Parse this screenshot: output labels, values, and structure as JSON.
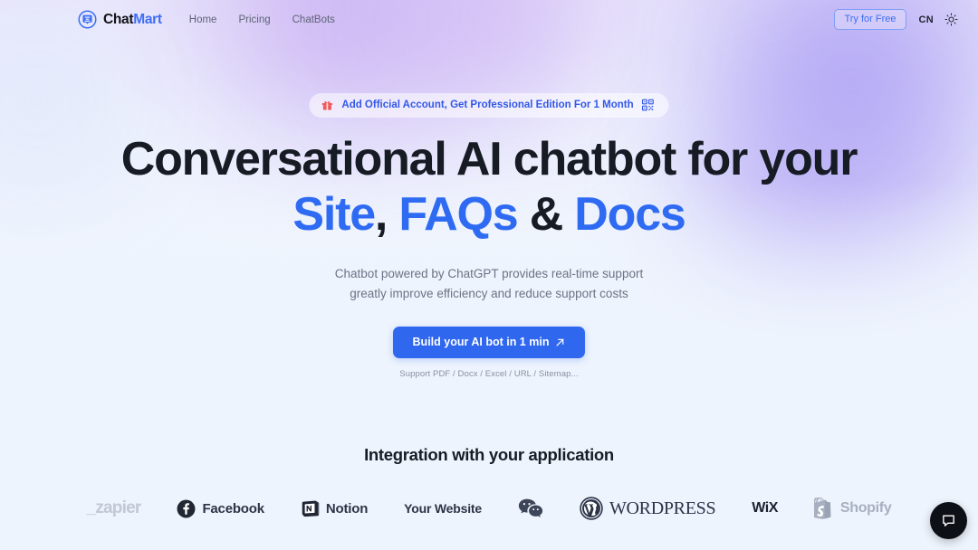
{
  "brand": {
    "name_dark": "Chat",
    "name_accent": "Mart",
    "logo_icon": "chat-bubble-lines-icon"
  },
  "nav": {
    "items": [
      {
        "label": "Home"
      },
      {
        "label": "Pricing"
      },
      {
        "label": "ChatBots"
      }
    ]
  },
  "header_actions": {
    "try_label": "Try for Free",
    "language_label": "CN",
    "theme_icon": "sun-icon"
  },
  "promo": {
    "gift_icon": "gift-icon",
    "text": "Add Official Account, Get Professional Edition For 1 Month",
    "qr_icon": "qr-code-icon"
  },
  "hero": {
    "headline_line1": "Conversational AI chatbot for your",
    "headline_part_site": "Site",
    "headline_comma": ",",
    "headline_part_faqs": "FAQs",
    "headline_amp": "&",
    "headline_part_docs": "Docs",
    "subtitle_line1": "Chatbot powered by ChatGPT provides real-time support",
    "subtitle_line2": "greatly improve efficiency and reduce support costs",
    "cta_label": "Build your AI bot in 1 min",
    "cta_icon": "arrow-up-right-icon",
    "support_note": "Support PDF / Docx / Excel / URL / Sitemap..."
  },
  "integration": {
    "title": "Integration with your application",
    "logos": [
      {
        "name": "Zapier",
        "label": "zapier",
        "icon": "zapier-logo"
      },
      {
        "name": "Facebook",
        "label": "Facebook",
        "icon": "facebook-logo"
      },
      {
        "name": "Notion",
        "label": "Notion",
        "icon": "notion-logo"
      },
      {
        "name": "Your Website",
        "label": "Your Website",
        "icon": "none"
      },
      {
        "name": "WeChat",
        "label": "",
        "icon": "wechat-logo"
      },
      {
        "name": "WordPress",
        "label": "WORDPRESS",
        "icon": "wordpress-logo"
      },
      {
        "name": "Wix",
        "label": "WiX",
        "icon": "wix-logo"
      },
      {
        "name": "Shopify",
        "label": "Shopify",
        "icon": "shopify-logo"
      }
    ]
  },
  "chat_widget": {
    "icon": "chat-bubble-icon"
  },
  "colors": {
    "accent_blue": "#2f6bf2",
    "brand_blue": "#3d6ef5",
    "promo_blue": "#3358e8",
    "text_dark": "#161b24",
    "text_muted": "#6b7385",
    "page_bg": "#eef4fd"
  }
}
